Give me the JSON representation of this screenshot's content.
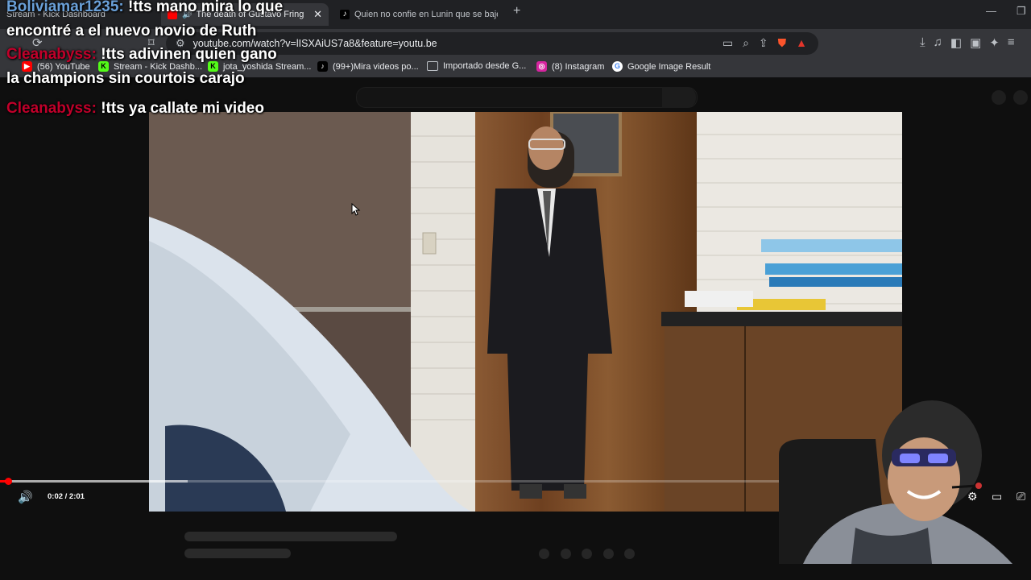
{
  "browser": {
    "tabs": [
      {
        "title": "Stream - Kick Dashboard",
        "active": false
      },
      {
        "title": "The death of Gustavo Fring if",
        "active": true
      },
      {
        "title": "Quien no confie en Lunin que se baje",
        "active": false
      }
    ],
    "url": "youtube.com/watch?v=lISXAiUS7a8&feature=youtu.be",
    "bookmarks": [
      {
        "label": "(56) YouTube",
        "icon": "youtube-icon"
      },
      {
        "label": "Stream - Kick Dashb...",
        "icon": "kick-icon"
      },
      {
        "label": "jota_yoshida Stream...",
        "icon": "kick-icon"
      },
      {
        "label": "(99+)Mira videos po...",
        "icon": "tiktok-icon"
      },
      {
        "label": "Importado desde G...",
        "icon": "folder-icon"
      },
      {
        "label": "(8) Instagram",
        "icon": "instagram-icon"
      },
      {
        "label": "Google Image Result",
        "icon": "google-icon"
      }
    ]
  },
  "player": {
    "time": "0:02 / 2:01",
    "progress_fraction": 0.006,
    "buffered_fraction": 0.24
  },
  "chat": [
    {
      "user": "Boliviamar1235:",
      "text": "!tts mano mira lo que encontré a el nuevo novio de Ruth",
      "color": "#6aa0d8"
    },
    {
      "user": "Cleanabyss:",
      "text": "!tts adivinen quien gano la champions sin courtois carajo",
      "color": "#c0002a"
    },
    {
      "user": "Cleanabyss:",
      "text": "!tts ya callate mi video",
      "color": "#c0002a"
    }
  ]
}
